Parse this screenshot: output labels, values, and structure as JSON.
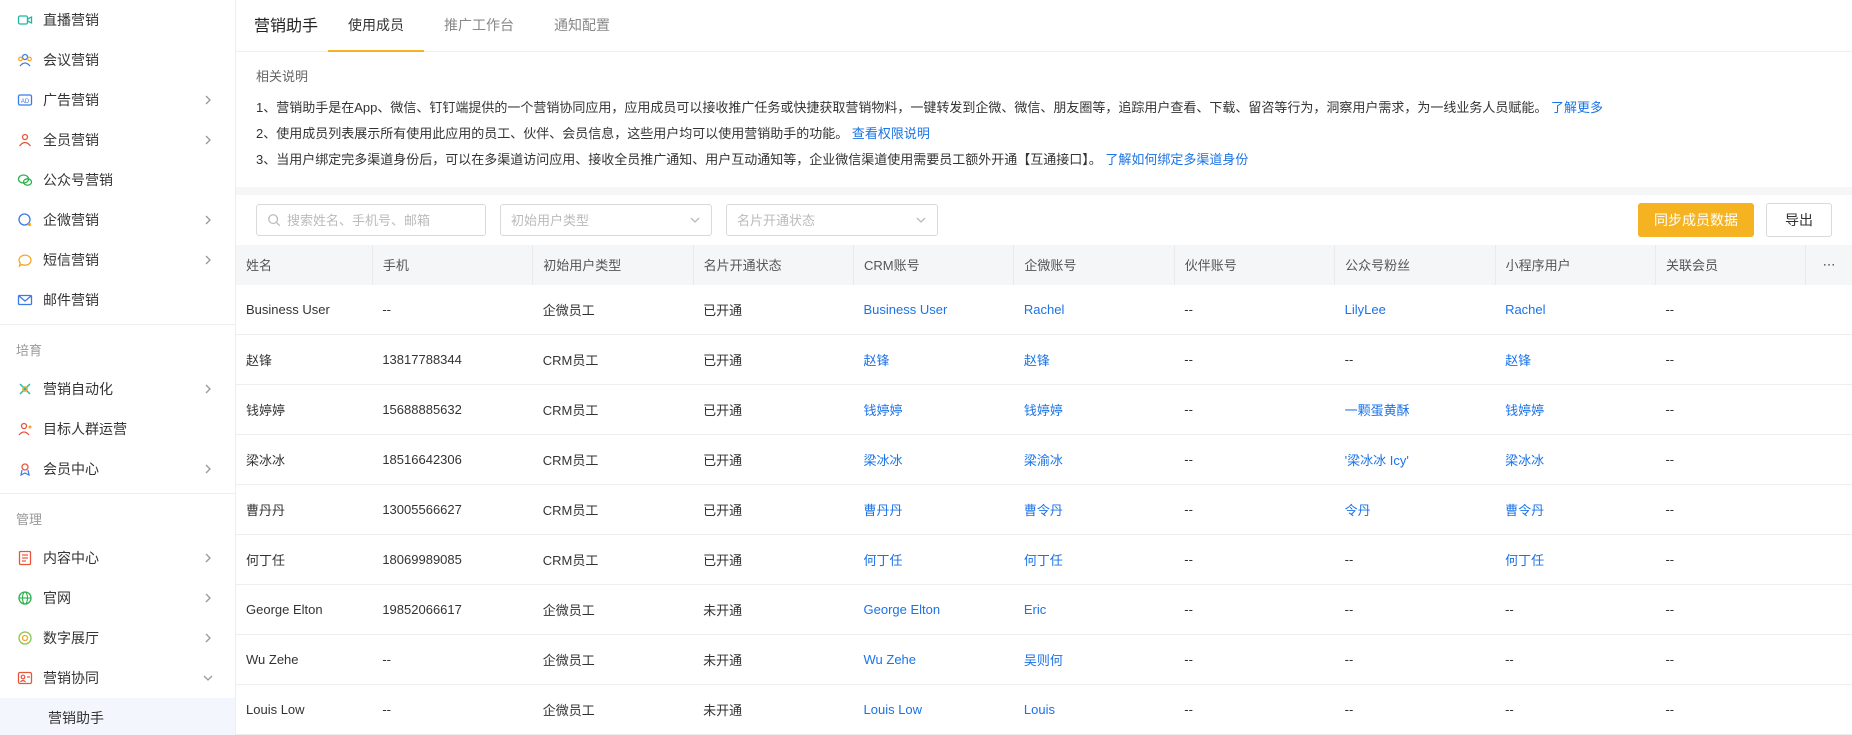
{
  "sidebar": {
    "items": [
      {
        "label": "直播营销",
        "icon": "video-icon",
        "has_arrow": false
      },
      {
        "label": "会议营销",
        "icon": "meeting-icon",
        "has_arrow": false
      },
      {
        "label": "广告营销",
        "icon": "ad-icon",
        "has_arrow": true
      },
      {
        "label": "全员营销",
        "icon": "team-icon",
        "has_arrow": true
      },
      {
        "label": "公众号营销",
        "icon": "wechat-icon",
        "has_arrow": false
      },
      {
        "label": "企微营销",
        "icon": "wecom-icon",
        "has_arrow": true
      },
      {
        "label": "短信营销",
        "icon": "sms-icon",
        "has_arrow": true
      },
      {
        "label": "邮件营销",
        "icon": "mail-icon",
        "has_arrow": false
      }
    ],
    "group_cultivate": "培育",
    "cultivate_items": [
      {
        "label": "营销自动化",
        "icon": "automation-icon",
        "has_arrow": true
      },
      {
        "label": "目标人群运营",
        "icon": "target-audience-icon",
        "has_arrow": false
      },
      {
        "label": "会员中心",
        "icon": "member-icon",
        "has_arrow": true
      }
    ],
    "group_manage": "管理",
    "manage_items": [
      {
        "label": "内容中心",
        "icon": "content-icon",
        "has_arrow": true
      },
      {
        "label": "官网",
        "icon": "website-icon",
        "has_arrow": true
      },
      {
        "label": "数字展厅",
        "icon": "hall-icon",
        "has_arrow": true
      },
      {
        "label": "营销协同",
        "icon": "collab-icon",
        "has_arrow": true,
        "expanded": true
      }
    ],
    "sub_item": "营销助手"
  },
  "header": {
    "title": "营销助手",
    "tabs": [
      "使用成员",
      "推广工作台",
      "通知配置"
    ],
    "active_tab": 0
  },
  "description": {
    "title": "相关说明",
    "line1": "1、营销助手是在App、微信、钉钉端提供的一个营销协同应用，应用成员可以接收推广任务或快捷获取营销物料，一键转发到企微、微信、朋友圈等，追踪用户查看、下载、留咨等行为，洞察用户需求，为一线业务人员赋能。",
    "line1_link": "了解更多",
    "line2": "2、使用成员列表展示所有使用此应用的员工、伙伴、会员信息，这些用户均可以使用营销助手的功能。",
    "line2_link": "查看权限说明",
    "line3": "3、当用户绑定完多渠道身份后，可以在多渠道访问应用、接收全员推广通知、用户互动通知等，企业微信渠道使用需要员工额外开通【互通接口】。",
    "line3_link": "了解如何绑定多渠道身份"
  },
  "filters": {
    "search_placeholder": "搜索姓名、手机号、邮箱",
    "user_type_placeholder": "初始用户类型",
    "card_status_placeholder": "名片开通状态",
    "sync_button": "同步成员数据",
    "export_button": "导出"
  },
  "table": {
    "columns": [
      "姓名",
      "手机",
      "初始用户类型",
      "名片开通状态",
      "CRM账号",
      "企微账号",
      "伙伴账号",
      "公众号粉丝",
      "小程序用户",
      "关联会员",
      "⋯"
    ],
    "rows": [
      [
        "Business User",
        "--",
        "企微员工",
        "已开通",
        "Business User",
        "Rachel",
        "--",
        "LilyLee",
        "Rachel",
        "--"
      ],
      [
        "赵锋",
        "13817788344",
        "CRM员工",
        "已开通",
        "赵锋",
        "赵锋",
        "--",
        "--",
        "赵锋",
        "--"
      ],
      [
        "钱婷婷",
        "15688885632",
        "CRM员工",
        "已开通",
        "钱婷婷",
        "钱婷婷",
        "--",
        "一颗蛋黄酥",
        "钱婷婷",
        "--"
      ],
      [
        "梁冰冰",
        "18516642306",
        "CRM员工",
        "已开通",
        "梁冰冰",
        "梁渝冰",
        "--",
        "'梁冰冰 Icy'",
        "梁冰冰",
        "--"
      ],
      [
        "曹丹丹",
        "13005566627",
        "CRM员工",
        "已开通",
        "曹丹丹",
        "曹令丹",
        "--",
        "令丹",
        "曹令丹",
        "--"
      ],
      [
        "何丁任",
        "18069989085",
        "CRM员工",
        "已开通",
        "何丁任",
        "何丁任",
        "--",
        "--",
        "何丁任",
        "--"
      ],
      [
        "George Elton",
        "19852066617",
        "企微员工",
        "未开通",
        "George Elton",
        "Eric",
        "--",
        "--",
        "--",
        "--"
      ],
      [
        "Wu Zehe",
        "--",
        "企微员工",
        "未开通",
        "Wu Zehe",
        "吴则何",
        "--",
        "--",
        "--",
        "--"
      ],
      [
        "Louis Low",
        "--",
        "企微员工",
        "未开通",
        "Louis Low",
        "Louis",
        "--",
        "--",
        "--",
        "--"
      ]
    ],
    "link_columns": [
      4,
      5,
      7,
      8
    ]
  },
  "colors": {
    "accent": "#f5b322",
    "link": "#1a73e8"
  }
}
